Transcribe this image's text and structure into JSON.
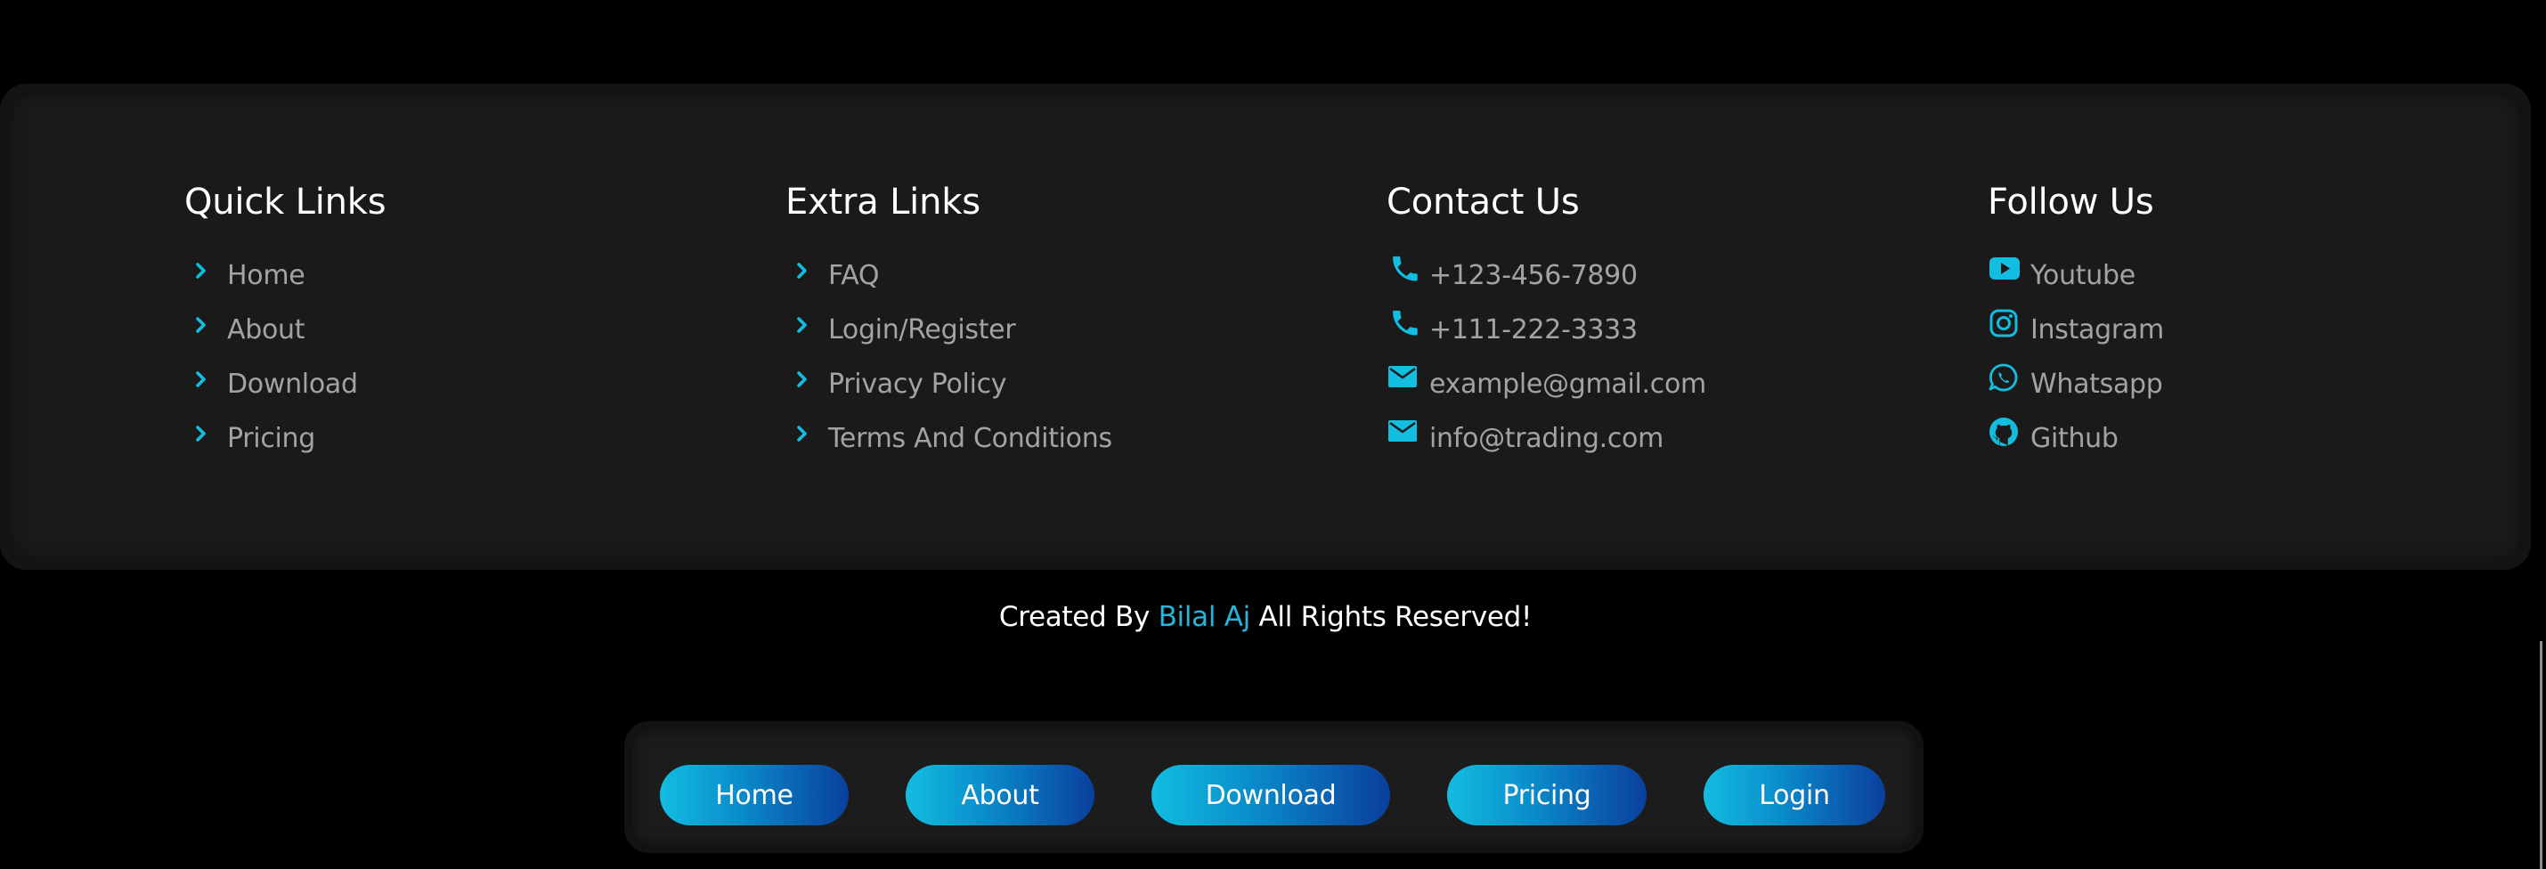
{
  "colors": {
    "accent": "#12bde0",
    "accent_dark": "#0a3f9e",
    "card_bg": "#1a1a1a",
    "page_bg": "#000000",
    "link_text": "#a3a3a3"
  },
  "footer": {
    "quick_links": {
      "title": "Quick Links",
      "items": [
        {
          "label": "Home",
          "icon": "chevron-right-icon"
        },
        {
          "label": "About",
          "icon": "chevron-right-icon"
        },
        {
          "label": "Download",
          "icon": "chevron-right-icon"
        },
        {
          "label": "Pricing",
          "icon": "chevron-right-icon"
        }
      ]
    },
    "extra_links": {
      "title": "Extra Links",
      "items": [
        {
          "label": "FAQ",
          "icon": "chevron-right-icon"
        },
        {
          "label": "Login/Register",
          "icon": "chevron-right-icon"
        },
        {
          "label": "Privacy Policy",
          "icon": "chevron-right-icon"
        },
        {
          "label": "Terms And Conditions",
          "icon": "chevron-right-icon"
        }
      ]
    },
    "contact": {
      "title": "Contact Us",
      "items": [
        {
          "label": "+123-456-7890",
          "icon": "phone-icon"
        },
        {
          "label": "+111-222-3333",
          "icon": "phone-icon"
        },
        {
          "label": "example@gmail.com",
          "icon": "mail-icon"
        },
        {
          "label": "info@trading.com",
          "icon": "mail-icon"
        }
      ]
    },
    "follow": {
      "title": "Follow Us",
      "items": [
        {
          "label": "Youtube",
          "icon": "youtube-icon"
        },
        {
          "label": "Instagram",
          "icon": "instagram-icon"
        },
        {
          "label": "Whatsapp",
          "icon": "whatsapp-icon"
        },
        {
          "label": "Github",
          "icon": "github-icon"
        }
      ]
    }
  },
  "credit": {
    "prefix": "Created By ",
    "author": "Bilal Aj",
    "suffix": " All Rights Reserved!"
  },
  "bottom_nav": {
    "buttons": [
      {
        "label": "Home"
      },
      {
        "label": "About"
      },
      {
        "label": "Download"
      },
      {
        "label": "Pricing"
      },
      {
        "label": "Login"
      }
    ]
  }
}
